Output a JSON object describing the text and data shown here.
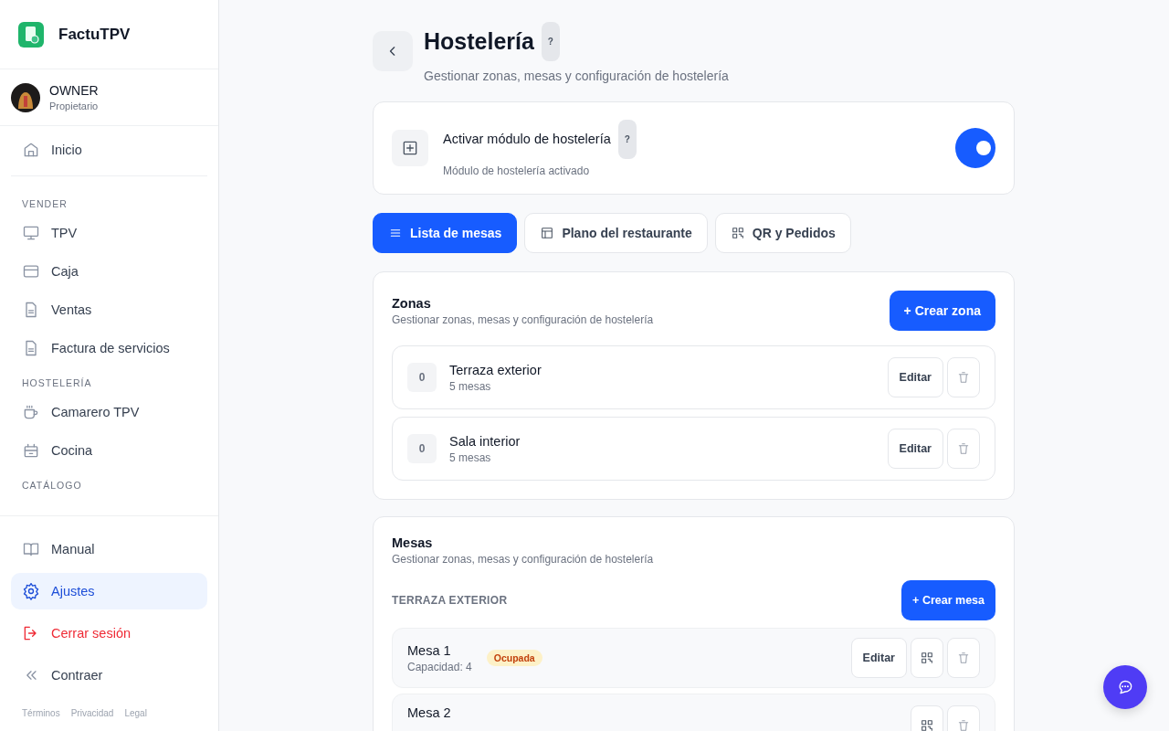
{
  "sidebar": {
    "brand": "FactuTPV",
    "user": {
      "name": "OWNER",
      "role": "Propietario"
    },
    "home": {
      "label": "Inicio",
      "selected": false
    },
    "sections": [
      {
        "title": "VENDER",
        "items": [
          {
            "label": "TPV",
            "selected": false
          },
          {
            "label": "Caja",
            "selected": false
          },
          {
            "label": "Ventas",
            "selected": false
          },
          {
            "label": "Factura de servicios",
            "selected": false
          }
        ]
      },
      {
        "title": "HOSTELERÍA",
        "items": [
          {
            "label": "Camarero TPV",
            "selected": false
          },
          {
            "label": "Cocina",
            "selected": false
          }
        ]
      },
      {
        "title": "CATÁLOGO"
      }
    ],
    "bottom": [
      {
        "label": "Manual",
        "selected": false,
        "kind": "normal"
      },
      {
        "label": "Ajustes",
        "selected": true,
        "kind": "normal"
      },
      {
        "label": "Cerrar sesión",
        "selected": false,
        "kind": "danger"
      },
      {
        "label": "Contraer",
        "selected": false,
        "kind": "normal"
      }
    ],
    "footer_links": [
      "Términos",
      "Privacidad",
      "Legal"
    ]
  },
  "header": {
    "title": "Hostelería",
    "help": "?",
    "subtitle": "Gestionar zonas, mesas y configuración de hostelería"
  },
  "module": {
    "title": "Activar módulo de hostelería",
    "help": "?",
    "status": "Módulo de hostelería activado",
    "on": true
  },
  "tabs": [
    {
      "label": "Lista de mesas",
      "selected": true
    },
    {
      "label": "Plano del restaurante",
      "selected": false
    },
    {
      "label": "QR y Pedidos",
      "selected": false
    }
  ],
  "zones": {
    "title": "Zonas",
    "subtitle": "Gestionar zonas, mesas y configuración de hostelería",
    "create": "+ Crear zona",
    "items": [
      {
        "count": "0",
        "name": "Terraza exterior",
        "tables": "5 mesas",
        "edit": "Editar"
      },
      {
        "count": "0",
        "name": "Sala interior",
        "tables": "5 mesas",
        "edit": "Editar"
      }
    ]
  },
  "tables": {
    "title": "Mesas",
    "subtitle": "Gestionar zonas, mesas y configuración de hostelería",
    "group": "TERRAZA EXTERIOR",
    "create": "+ Crear mesa",
    "items": [
      {
        "name": "Mesa 1",
        "capacity": "Capacidad: 4",
        "status": "Ocupada",
        "edit": "Editar"
      },
      {
        "name": "Mesa 2"
      }
    ]
  }
}
